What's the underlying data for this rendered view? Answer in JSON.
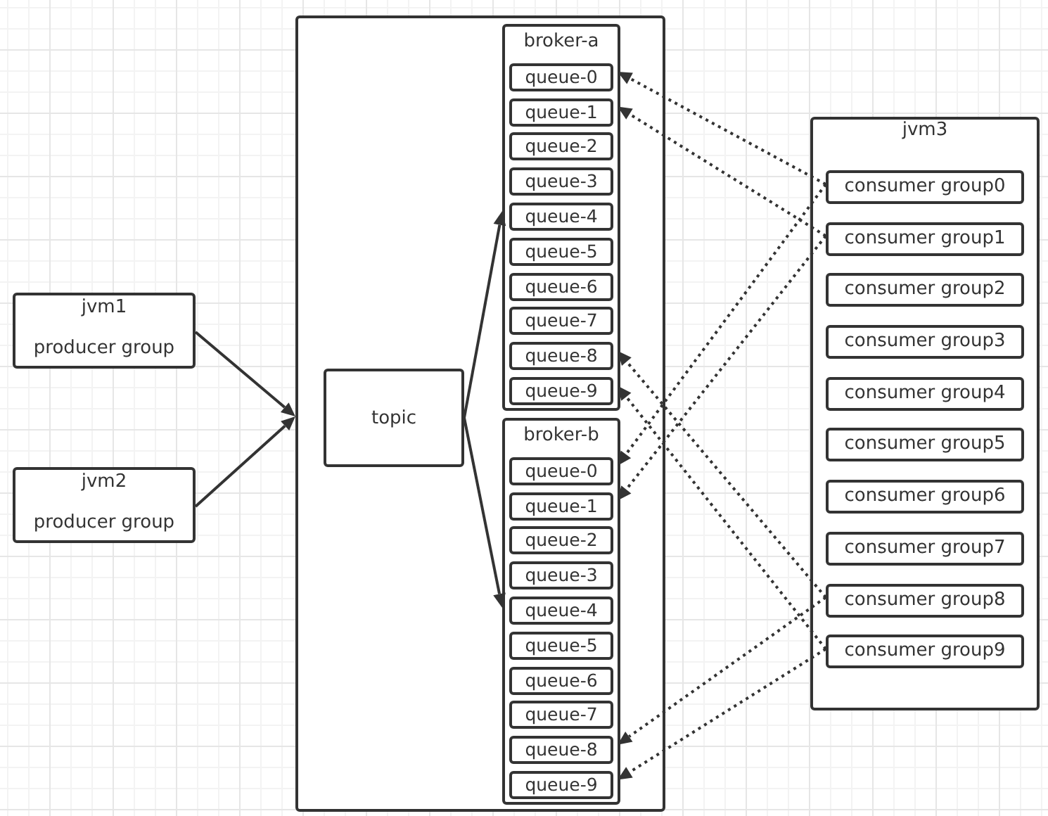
{
  "producers": [
    {
      "host": "jvm1",
      "label": "producer group"
    },
    {
      "host": "jvm2",
      "label": "producer group"
    }
  ],
  "topic": {
    "label": "topic"
  },
  "brokers": [
    {
      "name": "broker-a",
      "queues": [
        {
          "label": "queue-0",
          "consumed": true
        },
        {
          "label": "queue-1",
          "consumed": true
        },
        {
          "label": "queue-2",
          "consumed": false
        },
        {
          "label": "queue-3",
          "consumed": false
        },
        {
          "label": "queue-4",
          "consumed": false
        },
        {
          "label": "queue-5",
          "consumed": false
        },
        {
          "label": "queue-6",
          "consumed": false
        },
        {
          "label": "queue-7",
          "consumed": false
        },
        {
          "label": "queue-8",
          "consumed": true
        },
        {
          "label": "queue-9",
          "consumed": true
        }
      ]
    },
    {
      "name": "broker-b",
      "queues": [
        {
          "label": "queue-0",
          "consumed": true
        },
        {
          "label": "queue-1",
          "consumed": true
        },
        {
          "label": "queue-2",
          "consumed": false
        },
        {
          "label": "queue-3",
          "consumed": false
        },
        {
          "label": "queue-4",
          "consumed": false
        },
        {
          "label": "queue-5",
          "consumed": false
        },
        {
          "label": "queue-6",
          "consumed": false
        },
        {
          "label": "queue-7",
          "consumed": false
        },
        {
          "label": "queue-8",
          "consumed": true
        },
        {
          "label": "queue-9",
          "consumed": true
        }
      ]
    }
  ],
  "consumer_host": {
    "title": "jvm3",
    "groups": [
      {
        "label": "consumer group0"
      },
      {
        "label": "consumer group1"
      },
      {
        "label": "consumer group2"
      },
      {
        "label": "consumer group3"
      },
      {
        "label": "consumer group4"
      },
      {
        "label": "consumer group5"
      },
      {
        "label": "consumer group6"
      },
      {
        "label": "consumer group7"
      },
      {
        "label": "consumer group8"
      },
      {
        "label": "consumer group9"
      }
    ]
  }
}
